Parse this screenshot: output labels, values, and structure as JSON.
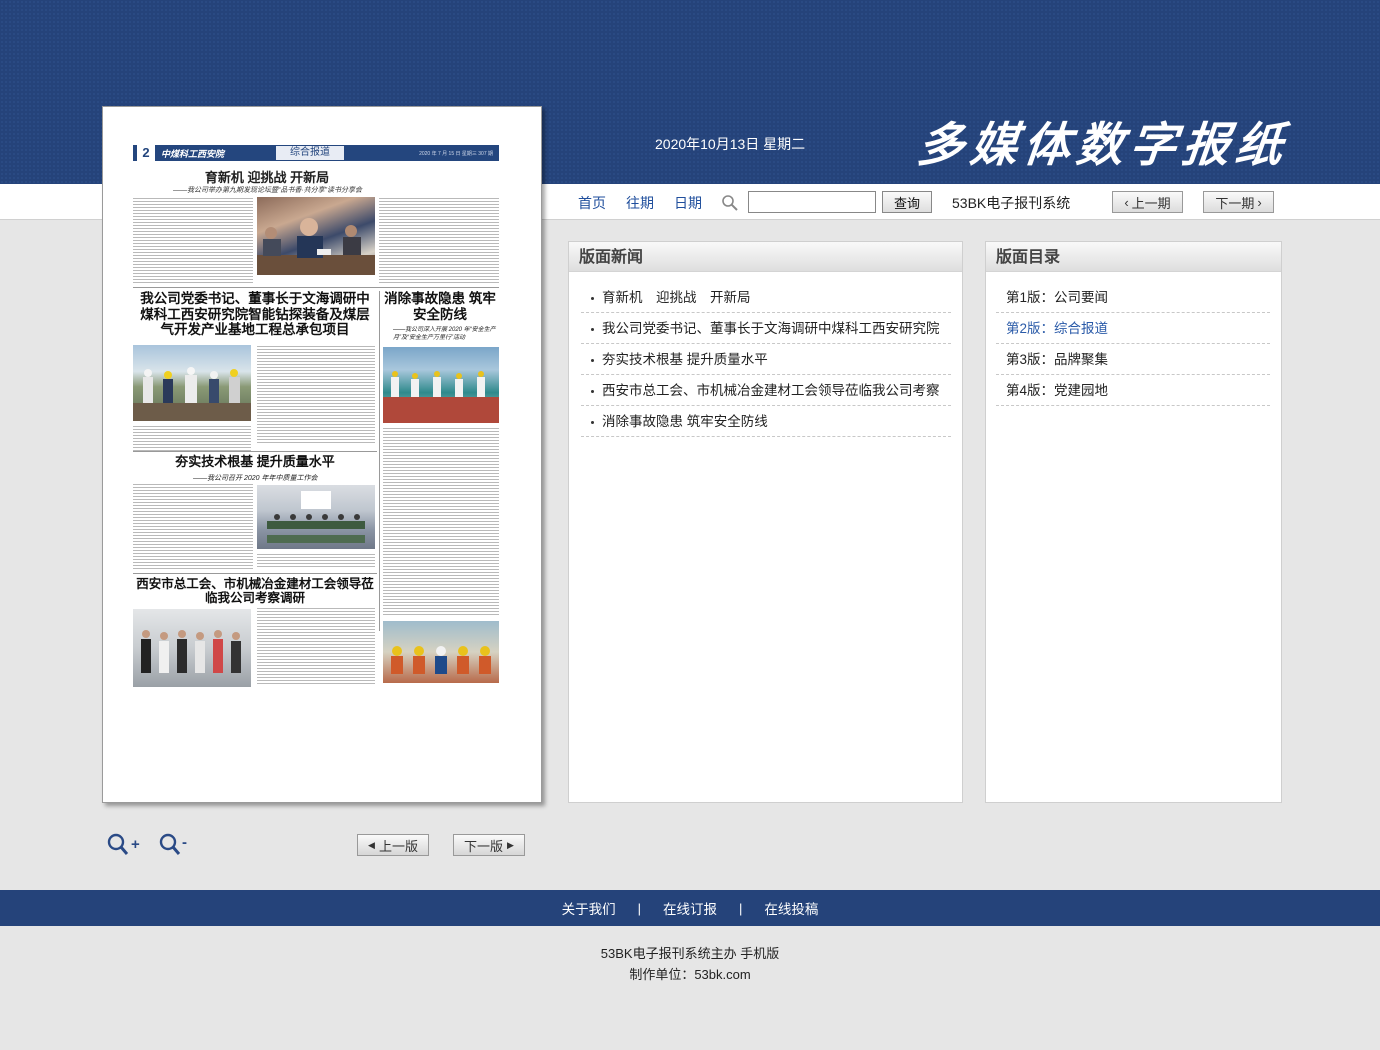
{
  "header": {
    "date": "2020年10月13日 星期二",
    "logo_text": "多媒体数字报纸"
  },
  "nav": {
    "home": "首页",
    "past_issues": "往期",
    "date": "日期",
    "search_value": "",
    "search_button": "查询",
    "system_name": "53BK电子报刊系统",
    "prev_issue": "上一期",
    "next_issue": "下一期"
  },
  "newspaper": {
    "page_number": "2",
    "masthead_logo": "中煤科工西安院",
    "section": "综合报道",
    "masthead_date": "2020 年 7 月 15 日  星期三 307 期",
    "headline": "育新机  迎挑战  开新局",
    "subhead": "——我公司举办第九期发现论坛暨“品书香·共分享”读书分享会",
    "story2_title": "我公司党委书记、董事长于文海调研中煤科工西安研究院智能钻探装备及煤层气开发产业基地工程总承包项目",
    "story3_title": "消除事故隐患 筑牢安全防线",
    "story3_sub": "——我公司深入开展 2020 年“安全生产月”及“安全生产万里行”活动",
    "story4_title": "夯实技术根基  提升质量水平",
    "story4_sub": "——我公司召开 2020 年年中质量工作会",
    "story5_title": "西安市总工会、市机械冶金建材工会领导莅临我公司考察调研"
  },
  "zoom": {
    "zoom_in_label": "+",
    "zoom_out_label": "-"
  },
  "pager": {
    "prev_page": "上一版",
    "next_page": "下一版"
  },
  "news_panel": {
    "title": "版面新闻",
    "items": [
      "育新机　迎挑战　开新局",
      "我公司党委书记、董事长于文海调研中煤科工西安研究院",
      "夯实技术根基 提升质量水平",
      "西安市总工会、市机械冶金建材工会领导莅临我公司考察",
      "消除事故隐患 筑牢安全防线"
    ]
  },
  "toc_panel": {
    "title": "版面目录",
    "items": [
      "第1版：公司要闻",
      "第2版：综合报道",
      "第3版：品牌聚集",
      "第4版：党建园地"
    ],
    "active_index": 1
  },
  "footer": {
    "about": "关于我们",
    "subscribe": "在线订报",
    "submit": "在线投稿",
    "separator": "|",
    "copyright": "53BK电子报刊系统主办 手机版",
    "producer": "制作单位：53bk.com"
  },
  "colors": {
    "brand_blue": "#25437a",
    "link_blue": "#1f4e9c",
    "active_toc": "#2a5aa8"
  }
}
